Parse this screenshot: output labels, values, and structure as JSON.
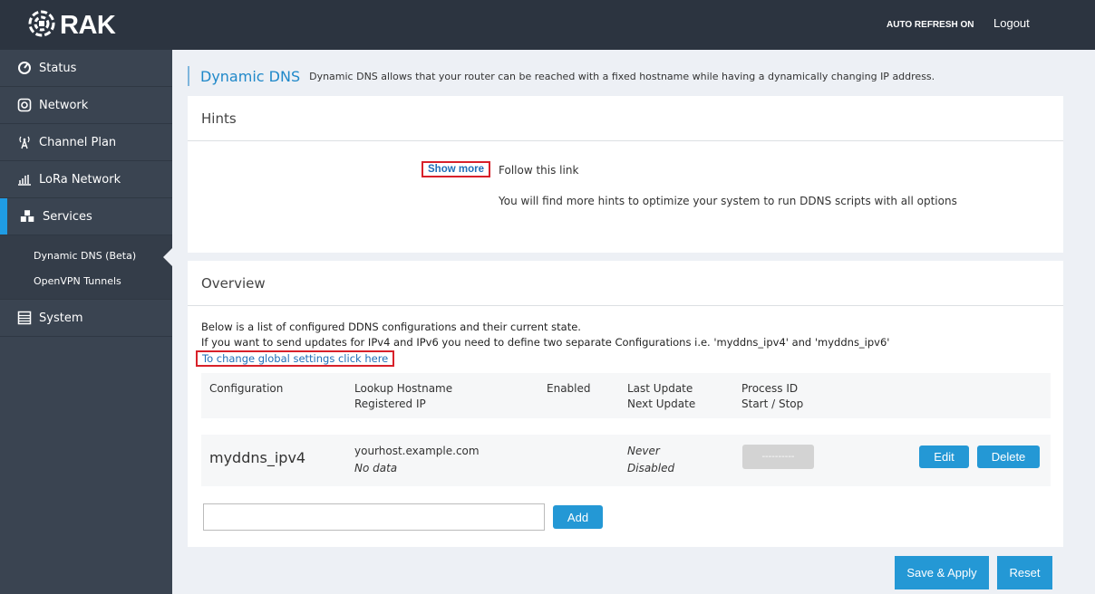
{
  "header": {
    "brand": "RAK",
    "auto_refresh": "AUTO REFRESH ON",
    "logout": "Logout"
  },
  "sidebar": {
    "items": [
      {
        "label": "Status",
        "icon": "status-icon"
      },
      {
        "label": "Network",
        "icon": "network-icon"
      },
      {
        "label": "Channel Plan",
        "icon": "antenna-icon"
      },
      {
        "label": "LoRa Network",
        "icon": "signal-bars-icon"
      },
      {
        "label": "Services",
        "icon": "cubes-icon",
        "active": true
      },
      {
        "label": "System",
        "icon": "server-icon"
      }
    ],
    "subitems": [
      {
        "label": "Dynamic DNS (Beta)",
        "active": true
      },
      {
        "label": "OpenVPN Tunnels"
      }
    ]
  },
  "page": {
    "title": "Dynamic DNS",
    "description": "Dynamic DNS allows that your router can be reached with a fixed hostname while having a dynamically changing IP address."
  },
  "hints": {
    "title": "Hints",
    "show_more": "Show more",
    "follow": "Follow this link",
    "description": "You will find more hints to optimize your system to run DDNS scripts with all options"
  },
  "overview": {
    "title": "Overview",
    "line1": "Below is a list of configured DDNS configurations and their current state.",
    "line2": "If you want to send updates for IPv4 and IPv6 you need to define two separate Configurations i.e. 'myddns_ipv4' and 'myddns_ipv6'",
    "global_link": "To change global settings click here",
    "columns": {
      "configuration": "Configuration",
      "lookup_hostname": "Lookup Hostname",
      "registered_ip": "Registered IP",
      "enabled": "Enabled",
      "last_update": "Last Update",
      "next_update": "Next Update",
      "process_id": "Process ID",
      "start_stop": "Start / Stop"
    },
    "rows": [
      {
        "configuration": "myddns_ipv4",
        "hostname": "yourhost.example.com",
        "registered_ip": "No data",
        "last_update": "Never",
        "next_update": "Disabled",
        "start_stop": "----------",
        "edit": "Edit",
        "delete": "Delete"
      }
    ],
    "add_input_value": "",
    "add_button": "Add"
  },
  "footer": {
    "save_apply": "Save & Apply",
    "reset": "Reset"
  },
  "colors": {
    "accent": "#2498d5",
    "topbar": "#2c3440",
    "sidebar": "#3a4451",
    "highlight_box": "#d8212a"
  }
}
